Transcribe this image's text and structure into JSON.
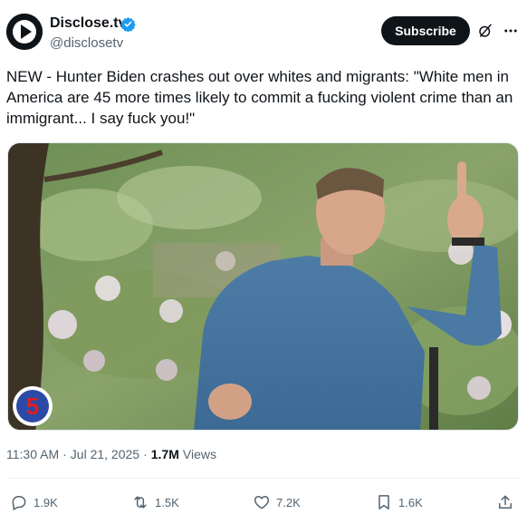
{
  "author": {
    "name": "Disclose.tv",
    "handle": "@disclosetv"
  },
  "header": {
    "subscribe_label": "Subscribe"
  },
  "tweet": {
    "text": "NEW - Hunter Biden crashes out over whites and migrants: \"White men in America are 45 more times likely to commit a fucking violent crime than an immigrant... I say fuck you!\"",
    "time": "11:30 AM",
    "separator": "·",
    "date": "Jul 21, 2025",
    "separator2": "·",
    "views_count": "1.7M",
    "views_label": "Views"
  },
  "media": {
    "channel_logo_text": "5"
  },
  "actions": {
    "replies": "1.9K",
    "reposts": "1.5K",
    "likes": "7.2K",
    "bookmarks": "1.6K"
  },
  "icons": {
    "avatar": "disclose-play-logo",
    "verified": "verified-badge-icon",
    "grok": "grok-icon",
    "more": "more-icon",
    "reply": "reply-icon",
    "repost": "repost-icon",
    "like": "heart-icon",
    "bookmark": "bookmark-icon",
    "share": "share-icon"
  },
  "colors": {
    "text": "#0f1419",
    "secondary": "#536471",
    "verified": "#1d9bf0",
    "button": "#0f1419"
  }
}
